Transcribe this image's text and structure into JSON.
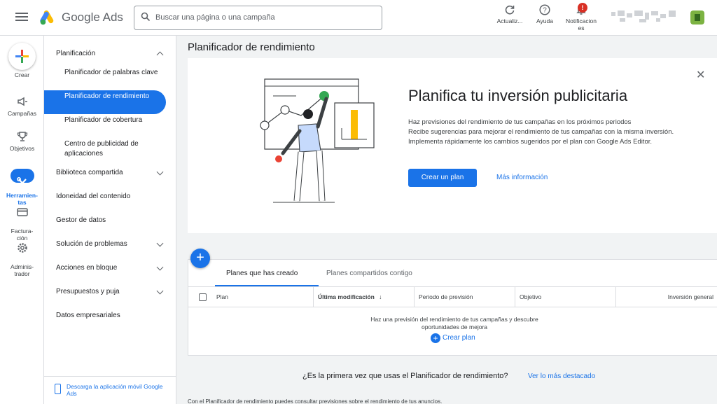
{
  "header": {
    "brand": "Google Ads",
    "search_placeholder": "Buscar una página o una campaña",
    "actions": [
      {
        "label": "Actualiz...",
        "icon": "refresh-icon"
      },
      {
        "label": "Ayuda",
        "icon": "help-icon"
      },
      {
        "label": "Notificacion\nes",
        "icon": "bell-icon",
        "badge": "!"
      }
    ],
    "accent": "#1a73e8"
  },
  "rail": {
    "create_label": "Crear",
    "items": [
      {
        "label": "Campañas",
        "icon": "megaphone-icon"
      },
      {
        "label": "Objetivos",
        "icon": "trophy-icon"
      },
      {
        "label": "Herramien-\ntas",
        "icon": "tools-icon",
        "active": true
      },
      {
        "label": "Factura-\nción",
        "icon": "credit-card-icon"
      },
      {
        "label": "Adminis-\ntrador",
        "icon": "gear-icon"
      }
    ]
  },
  "sidenav": {
    "section": "Planificación",
    "sub_items": [
      "Planificador de palabras clave",
      "Planificador de rendimiento",
      "Planificador de cobertura",
      "Centro de publicidad de aplicaciones"
    ],
    "active_sub": "Planificador de rendimiento",
    "groups": [
      {
        "label": "Biblioteca compartida",
        "expandable": true
      },
      {
        "label": "Idoneidad del contenido",
        "expandable": false
      },
      {
        "label": "Gestor de datos",
        "expandable": false
      },
      {
        "label": "Solución de problemas",
        "expandable": true
      },
      {
        "label": "Acciones en bloque",
        "expandable": true
      },
      {
        "label": "Presupuestos y puja",
        "expandable": true
      },
      {
        "label": "Datos empresariales",
        "expandable": false
      }
    ],
    "download_app": "Descarga la aplicación móvil Google Ads"
  },
  "main": {
    "page_title": "Planificador de rendimiento",
    "promo": {
      "title": "Planifica tu inversión publicitaria",
      "lines": [
        "Haz previsiones del rendimiento de tus campañas en los próximos periodos",
        "Recibe sugerencias para mejorar el rendimiento de tus campañas con la misma inversión.",
        "Implementa rápidamente los cambios sugeridos por el plan con Google Ads Editor."
      ],
      "primary_button": "Crear un plan",
      "link": "Más información"
    },
    "plans": {
      "tabs": [
        "Planes que has creado",
        "Planes compartidos contigo"
      ],
      "columns": [
        "Plan",
        "Última modificación",
        "Periodo de previsión",
        "Objetivo",
        "Inversión general"
      ],
      "empty_text": "Haz una previsión del rendimiento de tus campañas y descubre oportunidades de mejora",
      "empty_create": "Crear plan"
    },
    "first_time_question": "¿Es la primera vez que usas el Planificador de rendimiento?",
    "first_time_link": "Ver lo más destacado",
    "footer_text": "Con el Planificador de rendimiento puedes consultar previsiones sobre el rendimiento de tus anuncios."
  }
}
